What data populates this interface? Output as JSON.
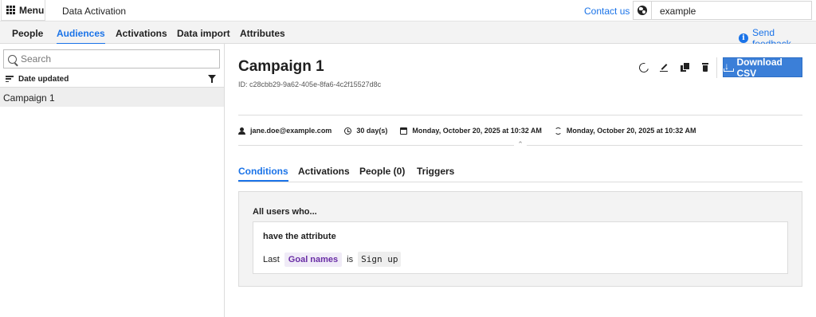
{
  "topbar": {
    "menu_label": "Menu",
    "app_title": "Data Activation",
    "contact_label": "Contact us",
    "tenant": "example"
  },
  "nav": {
    "tabs": [
      {
        "label": "People"
      },
      {
        "label": "Audiences",
        "active": true
      },
      {
        "label": "Activations"
      },
      {
        "label": "Data import"
      },
      {
        "label": "Attributes"
      }
    ],
    "feedback_label": "Send feedback"
  },
  "sidebar": {
    "search_placeholder": "Search",
    "sort_label": "Date updated",
    "items": [
      {
        "label": "Campaign 1",
        "selected": true
      }
    ]
  },
  "audience": {
    "title": "Campaign 1",
    "id_text": "ID: c28cbb29-9a62-405e-8fa6-4c2f15527d8c",
    "download_label": "Download CSV",
    "owner": "jane.doe@example.com",
    "retention": "30 day(s)",
    "created": "Monday, October 20, 2025 at 10:32 AM",
    "updated": "Monday, October 20, 2025 at 10:32 AM"
  },
  "tabs": [
    {
      "label": "Conditions",
      "active": true
    },
    {
      "label": "Activations"
    },
    {
      "label": "People (0)"
    },
    {
      "label": "Triggers"
    }
  ],
  "conditions": {
    "intro": "All users who...",
    "heading": "have the attribute",
    "modifier": "Last",
    "attribute": "Goal names",
    "operator": "is",
    "value": "Sign up"
  },
  "colors": {
    "accent": "#1a73e8",
    "button": "#3b7fd8",
    "attribute_chip_text": "#6a2ea6"
  }
}
